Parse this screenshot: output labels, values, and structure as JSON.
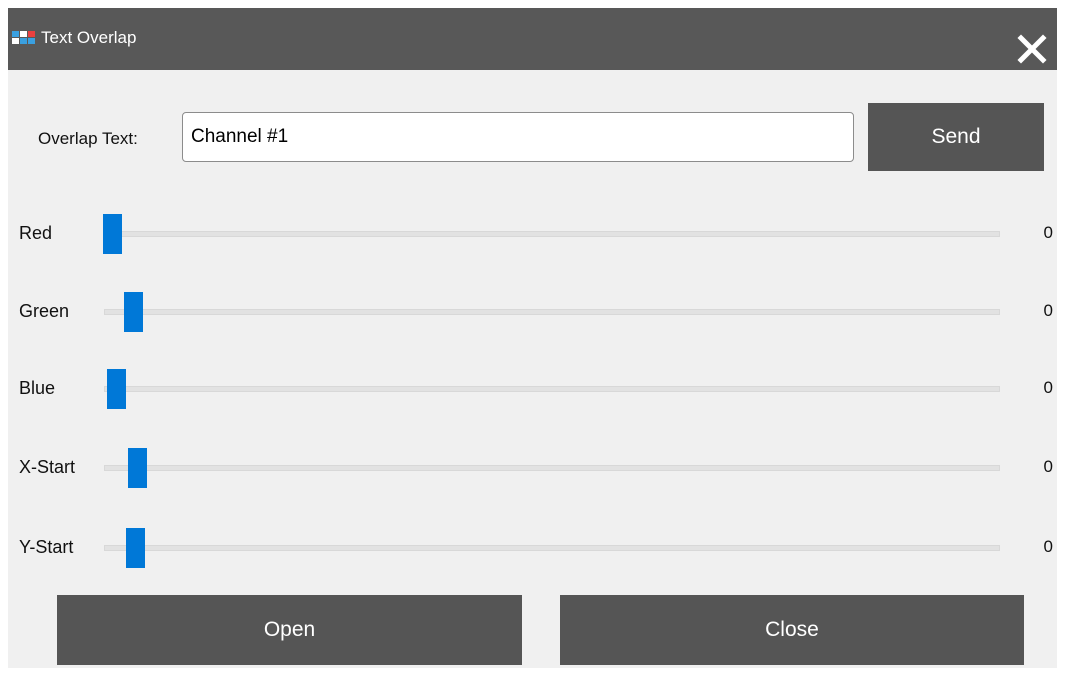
{
  "window": {
    "title": "Text Overlap",
    "close_icon": "close-icon",
    "app_icon": "app-icon"
  },
  "overlap": {
    "label": "Overlap Text:",
    "value": "Channel #1",
    "send_label": "Send"
  },
  "sliders": [
    {
      "label": "Red",
      "value": "0"
    },
    {
      "label": "Green",
      "value": "0"
    },
    {
      "label": "Blue",
      "value": "0"
    },
    {
      "label": "X-Start",
      "value": "0"
    },
    {
      "label": "Y-Start",
      "value": "0"
    }
  ],
  "buttons": {
    "open_label": "Open",
    "close_label": "Close"
  },
  "colors": {
    "titlebar": "#585858",
    "accent": "#0078d7",
    "button": "#555555",
    "background": "#f0f0f0"
  }
}
